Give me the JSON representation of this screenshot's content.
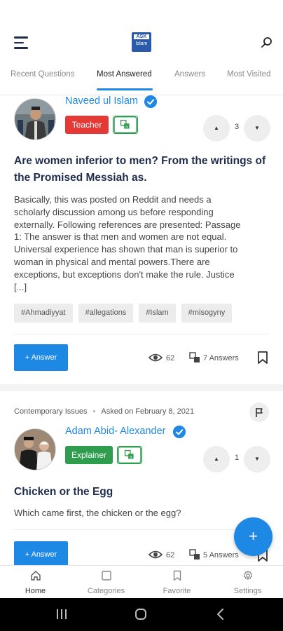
{
  "header": {
    "logo_top": "ASK",
    "logo_bottom": "Islam",
    "tabs": [
      {
        "label": "Recent Questions"
      },
      {
        "label": "Most Answered"
      },
      {
        "label": "Answers"
      },
      {
        "label": "Most Visited"
      }
    ],
    "active_tab": "Most Answered"
  },
  "questions": [
    {
      "author": "Naveed ul Islam",
      "role": "Teacher",
      "role_color": "#e53935",
      "votes": "3",
      "title_line1": "Are women inferior to men? From the writings of",
      "title_line2": "the Promised Messiah as.",
      "body_lines": [
        "Basically, this was posted on Reddit and needs a",
        "scholarly discussion among us before responding",
        "externally. Following references are presented: Passage",
        "1: The answer is that men and women are not equal.",
        "Universal experience has shown that man is superior to",
        "woman in physical and mental powers.There are",
        "exceptions, but exceptions don't make the rule. Justice",
        "[...]"
      ],
      "tags": [
        "#Ahmadiyyat",
        "#allegations",
        "#Islam",
        "#misogyny"
      ],
      "answer_label": "+ Answer",
      "views": "62",
      "answers": "7 Answers"
    },
    {
      "category": "Contemporary Issues",
      "asked": "Asked on February 8, 2021",
      "author": "Adam Abid- Alexander",
      "role": "Explainer",
      "role_color": "#2e9d4d",
      "votes": "1",
      "title": "Chicken or the Egg",
      "body": "Which came first, the chicken or the egg?",
      "answer_label": "+ Answer",
      "views": "62",
      "answers": "5 Answers"
    }
  ],
  "fab_label": "+",
  "bottom_nav": [
    {
      "label": "Home",
      "icon": "home-icon"
    },
    {
      "label": "Categories",
      "icon": "categories-icon"
    },
    {
      "label": "Favorite",
      "icon": "bookmark-icon"
    },
    {
      "label": "Settings",
      "icon": "gear-icon"
    }
  ],
  "colors": {
    "accent": "#1e88e5",
    "teacher": "#e53935",
    "explainer": "#2e9d4d"
  }
}
